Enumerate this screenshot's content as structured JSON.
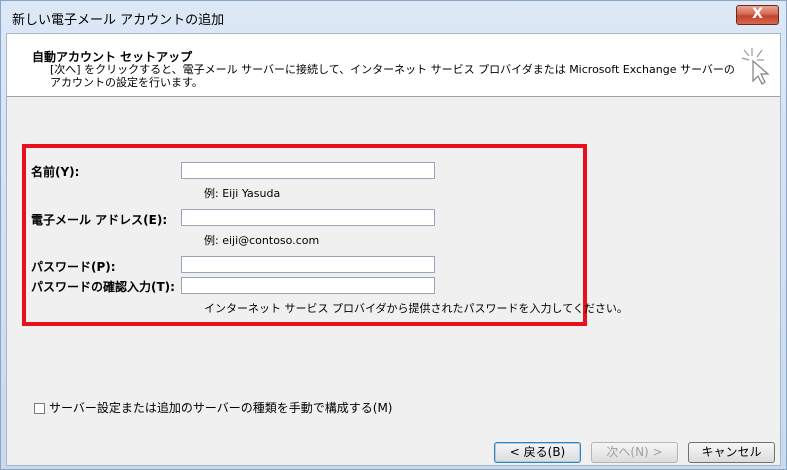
{
  "window": {
    "title": "新しい電子メール アカウントの追加",
    "close_symbol": "X"
  },
  "header": {
    "title": "自動アカウント セットアップ",
    "description": "[次へ] をクリックすると、電子メール サーバーに接続して、インターネット サービス プロバイダまたは Microsoft Exchange サーバーのアカウントの設定を行います。",
    "icon": "wizard-cursor-icon"
  },
  "form": {
    "name_label": "名前(Y):",
    "name_value": "",
    "name_hint": "例: Eiji Yasuda",
    "email_label": "電子メール アドレス(E):",
    "email_value": "",
    "email_hint": "例: eiji@contoso.com",
    "password_label": "パスワード(P):",
    "password_value": "",
    "confirm_label": "パスワードの確認入力(T):",
    "confirm_value": "",
    "password_hint": "インターネット サービス プロバイダから提供されたパスワードを入力してください。"
  },
  "manual_config": {
    "label": "サーバー設定または追加のサーバーの種類を手動で構成する(M)",
    "checked": false
  },
  "buttons": {
    "back": "< 戻る(B)",
    "next": "次へ(N) >",
    "cancel": "キャンセル"
  },
  "colors": {
    "highlight_border": "#e8101a",
    "close_button": "#c4412a"
  }
}
